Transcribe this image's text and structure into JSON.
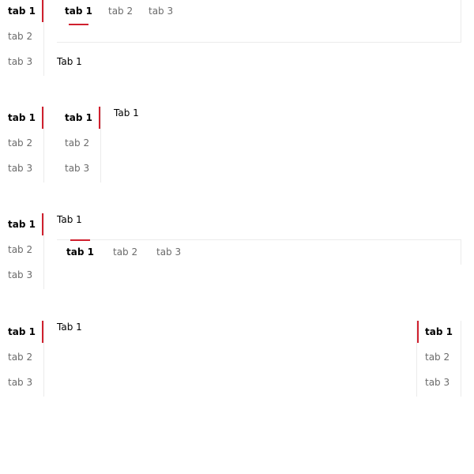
{
  "demos": [
    {
      "outer_tabs": [
        "tab 1",
        "tab 2",
        "tab 3"
      ],
      "inner_tabs": [
        "tab 1",
        "tab 2",
        "tab 3"
      ],
      "content": "Tab 1"
    },
    {
      "outer_tabs": [
        "tab 1",
        "tab 2",
        "tab 3"
      ],
      "inner_tabs": [
        "tab 1",
        "tab 2",
        "tab 3"
      ],
      "content": "Tab 1"
    },
    {
      "outer_tabs": [
        "tab 1",
        "tab 2",
        "tab 3"
      ],
      "inner_tabs": [
        "tab 1",
        "tab 2",
        "tab 3"
      ],
      "content": "Tab 1"
    },
    {
      "outer_tabs": [
        "tab 1",
        "tab 2",
        "tab 3"
      ],
      "inner_tabs": [
        "tab 1",
        "tab 2",
        "tab 3"
      ],
      "content": "Tab 1"
    }
  ],
  "active_tab_index": 0,
  "colors": {
    "accent": "#d0202e",
    "divider": "#ebebeb",
    "inactive_text": "#6b6b6b",
    "active_text": "#000000"
  }
}
